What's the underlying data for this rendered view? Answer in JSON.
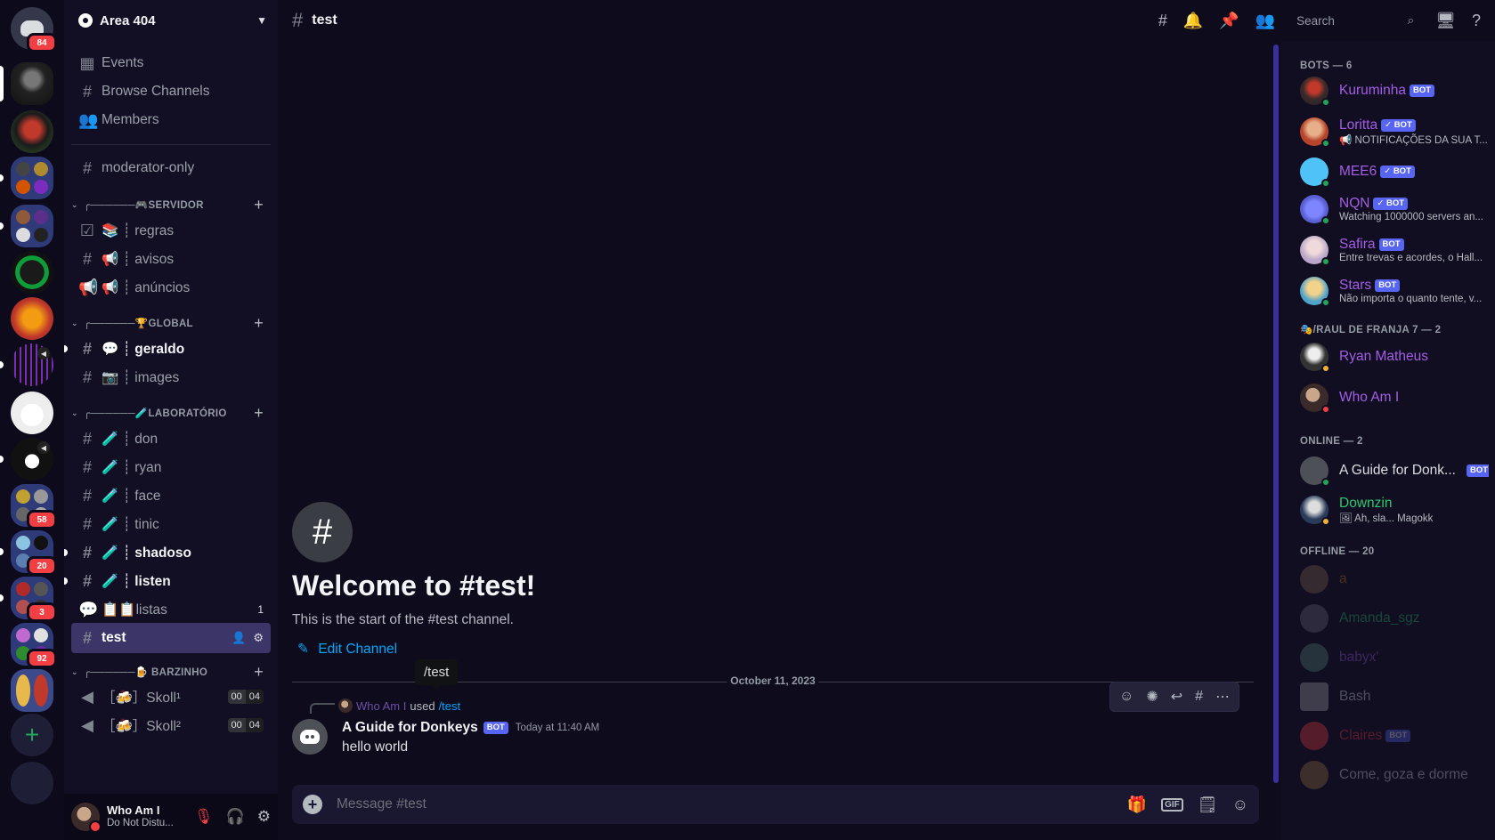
{
  "rail": {
    "home_badge": "84",
    "badges": {
      "s11": "58",
      "s12": "20",
      "s13": "3",
      "s14": "92"
    }
  },
  "guild": {
    "name": "Area 404"
  },
  "sidebar": {
    "events": "Events",
    "browse": "Browse Channels",
    "members": "Members",
    "moderator": "moderator-only",
    "cat_servidor": "╭──────🎮SERVIDOR",
    "regras": "📚 ┊ regras",
    "avisos": "📢 ┊ avisos",
    "anuncios": "📢 ┊ anúncios",
    "cat_global": "╭──────🏆GLOBAL",
    "geraldo": "💬 ┊ geraldo",
    "images": "📷 ┊ images",
    "cat_lab": "╭──────🧪LABORATÓRIO",
    "don": "🧪 ┊ don",
    "ryan": "🧪 ┊ ryan",
    "face": "🧪 ┊ face",
    "tinic": "🧪 ┊ tinic",
    "shadoso": "🧪 ┊ shadoso",
    "listen": "🧪 ┊ listen",
    "listas": "📋📋listas",
    "listas_count": "1",
    "test": "test",
    "cat_barzinho": "╭──────🍺 BARZINHO",
    "skoll1": "［🍻］Skoll¹",
    "skoll2": "［🍻］Skoll²",
    "voice_time_a": "00",
    "voice_time_b": "04"
  },
  "user": {
    "name": "Who Am I",
    "status": "Do Not Distu..."
  },
  "topbar": {
    "channel": "test",
    "search_placeholder": "Search"
  },
  "chat": {
    "welcome_title": "Welcome to #test!",
    "welcome_sub": "This is the start of the #test channel.",
    "edit_channel": "Edit Channel",
    "tooltip": "/test",
    "date": "October 11, 2023",
    "reply_user": "Who Am I",
    "reply_used": "used",
    "reply_cmd": "/test",
    "author": "A Guide for Donkeys",
    "bot_tag": "BOT",
    "time": "Today at 11:40 AM",
    "body": "hello world",
    "composer_placeholder": "Message #test",
    "gif": "GIF"
  },
  "members": {
    "cat_bots": "BOTS — 6",
    "cat_raul": "🎭/RAUL DE FRANJA 7 — 2",
    "cat_online": "ONLINE — 2",
    "cat_offline": "OFFLINE — 20",
    "bot_tag": "BOT",
    "verified_bot_tag": "✓ BOT",
    "list": [
      {
        "name": "Kuruminha",
        "sub": "",
        "color": "#a45ee5"
      },
      {
        "name": "Loritta",
        "sub": "📢 NOTIFICAÇÕES DA SUA T...",
        "color": "#a45ee5"
      },
      {
        "name": "MEE6",
        "sub": "",
        "color": "#a45ee5"
      },
      {
        "name": "NQN",
        "sub": "Watching 1000000 servers an...",
        "color": "#a45ee5"
      },
      {
        "name": "Safira",
        "sub": "Entre trevas e acordes, o Hall...",
        "color": "#a45ee5"
      },
      {
        "name": "Stars",
        "sub": "Não importa o quanto tente, v...",
        "color": "#a45ee5"
      },
      {
        "name": "Ryan Matheus",
        "sub": "",
        "color": "#a45ee5"
      },
      {
        "name": "Who Am I",
        "sub": "",
        "color": "#a45ee5"
      },
      {
        "name": "A Guide for Donk...",
        "sub": "",
        "color": "#dbdee1"
      },
      {
        "name": "Downzin",
        "sub": "🖼 Ah, sla... Magokk",
        "color": "#2dc770"
      },
      {
        "name": "a",
        "sub": "",
        "color": "#c27c0e"
      },
      {
        "name": "Amanda_sgz",
        "sub": "",
        "color": "#2dc770"
      },
      {
        "name": "babyx'",
        "sub": "",
        "color": "#a45ee5"
      },
      {
        "name": "Bash",
        "sub": "",
        "color": "#dbdee1"
      },
      {
        "name": "Claires",
        "sub": "",
        "color": "#f23f43"
      },
      {
        "name": "Come, goza e dorme",
        "sub": "",
        "color": "#dbdee1"
      }
    ]
  }
}
